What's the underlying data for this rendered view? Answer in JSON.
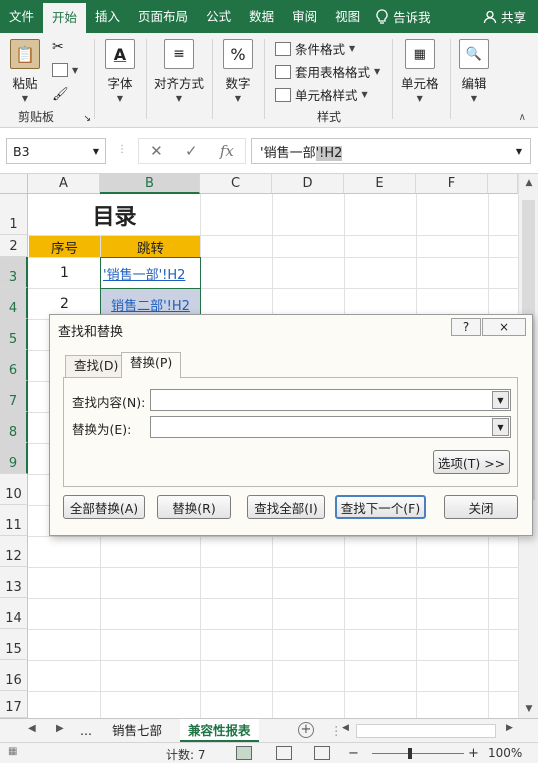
{
  "tabs": {
    "file": "文件",
    "home": "开始",
    "insert": "插入",
    "layout": "页面布局",
    "formulas": "公式",
    "data": "数据",
    "review": "审阅",
    "view": "视图",
    "tell_me": "告诉我",
    "share": "共享"
  },
  "ribbon": {
    "paste": "粘贴",
    "clipboard": "剪贴板",
    "font": "字体",
    "alignment": "对齐方式",
    "number": "数字",
    "conditional_format": "条件格式",
    "table_format": "套用表格格式",
    "cell_style": "单元格样式",
    "styles": "样式",
    "cells": "单元格",
    "editing": "编辑"
  },
  "formula_bar": {
    "name_box": "B3",
    "formula_prefix": "'销售一部",
    "formula_selected": "'!H2"
  },
  "columns": [
    "A",
    "B",
    "C",
    "D",
    "E",
    "F"
  ],
  "rows": [
    "1",
    "2",
    "3",
    "4",
    "5",
    "6",
    "7",
    "8",
    "9",
    "10",
    "11",
    "12",
    "13",
    "14",
    "15",
    "16",
    "17"
  ],
  "sheet": {
    "title": "目录",
    "header_no": "序号",
    "header_jump": "跳转",
    "row3_no": "1",
    "row3_link": "'销售一部'!H2",
    "row4_no": "2",
    "row4_link": "销售二部'!H2"
  },
  "dialog": {
    "title": "查找和替换",
    "help": "?",
    "close_x": "×",
    "tab_find": "查找(D)",
    "tab_replace": "替换(P)",
    "find_label": "查找内容(N):",
    "replace_label": "替换为(E):",
    "find_value": "",
    "replace_value": "",
    "options": "选项(T) >>",
    "replace_all": "全部替换(A)",
    "replace": "替换(R)",
    "find_all": "查找全部(I)",
    "find_next": "查找下一个(F)",
    "close": "关闭"
  },
  "sheet_tabs": {
    "ellipsis": "...",
    "tab1": "销售七部",
    "tab2": "兼容性报表"
  },
  "status": {
    "count": "计数: 7",
    "zoom": "100%"
  },
  "colors": {
    "accent": "#217346",
    "header_fill": "#f5b800",
    "link": "#1f5fbf"
  }
}
